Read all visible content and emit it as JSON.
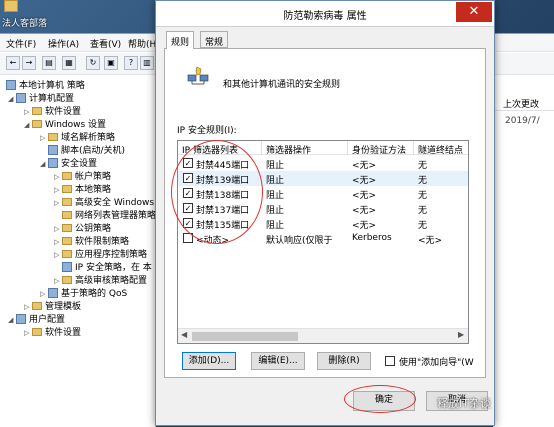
{
  "desktop": {
    "icon_label": "法人客部落"
  },
  "mmc": {
    "menu": [
      "文件(F)",
      "操作(A)",
      "查看(V)",
      "帮助(H)"
    ],
    "toolbar_icons": [
      "back-icon",
      "forward-icon",
      "up-icon",
      "show-hide-tree-icon",
      "refresh-icon",
      "export-icon",
      "help-icon",
      "properties-icon"
    ],
    "tree": [
      {
        "label": "本地计算机 策略",
        "indent": 0,
        "icon": "policy"
      },
      {
        "label": "计算机配置",
        "indent": 1,
        "icon": "computer"
      },
      {
        "label": "软件设置",
        "indent": 2,
        "icon": "folder"
      },
      {
        "label": "Windows 设置",
        "indent": 2,
        "icon": "folder"
      },
      {
        "label": "域名解析策略",
        "indent": 3,
        "icon": "folder"
      },
      {
        "label": "脚本(启动/关机)",
        "indent": 3,
        "icon": "script"
      },
      {
        "label": "安全设置",
        "indent": 3,
        "icon": "shield"
      },
      {
        "label": "帐户策略",
        "indent": 4,
        "icon": "folder"
      },
      {
        "label": "本地策略",
        "indent": 4,
        "icon": "folder"
      },
      {
        "label": "高级安全 Windows",
        "indent": 4,
        "icon": "folder"
      },
      {
        "label": "网络列表管理器策略",
        "indent": 4,
        "icon": "folder"
      },
      {
        "label": "公钥策略",
        "indent": 4,
        "icon": "folder"
      },
      {
        "label": "软件限制策略",
        "indent": 4,
        "icon": "folder"
      },
      {
        "label": "应用程序控制策略",
        "indent": 4,
        "icon": "folder"
      },
      {
        "label": "IP 安全策略，在 本",
        "indent": 4,
        "icon": "ipsec"
      },
      {
        "label": "高级审核策略配置",
        "indent": 4,
        "icon": "folder"
      },
      {
        "label": "基于策略的 QoS",
        "indent": 3,
        "icon": "chart"
      },
      {
        "label": "管理模板",
        "indent": 2,
        "icon": "folder"
      },
      {
        "label": "用户配置",
        "indent": 1,
        "icon": "user"
      },
      {
        "label": "软件设置",
        "indent": 2,
        "icon": "folder"
      }
    ],
    "right": {
      "column_header": "上次更改",
      "value": "2019/7/"
    }
  },
  "dialog": {
    "title": "防范勒索病毒 属性",
    "close_glyph": "✕",
    "tabs": [
      "规则",
      "常规"
    ],
    "rules_desc": "和其他计算机通讯的安全规则",
    "list_label": "IP 安全规则(I):",
    "columns": [
      "IP 筛选器列表",
      "筛选器操作",
      "身份验证方法",
      "隧道终结点"
    ],
    "rows": [
      {
        "checked": true,
        "filter": "封禁445端口",
        "action": "阻止",
        "auth": "<无>",
        "tunnel": "无"
      },
      {
        "checked": true,
        "filter": "封禁139端口",
        "action": "阻止",
        "auth": "<无>",
        "tunnel": "无"
      },
      {
        "checked": true,
        "filter": "封禁138端口",
        "action": "阻止",
        "auth": "<无>",
        "tunnel": "无"
      },
      {
        "checked": true,
        "filter": "封禁137端口",
        "action": "阻止",
        "auth": "<无>",
        "tunnel": "无"
      },
      {
        "checked": true,
        "filter": "封禁135端口",
        "action": "阻止",
        "auth": "<无>",
        "tunnel": "无"
      },
      {
        "checked": false,
        "filter": "<动态>",
        "action": "默认响应(仅限于",
        "auth": "Kerberos",
        "tunnel": "<无>"
      }
    ],
    "buttons": {
      "add": "添加(D)...",
      "edit": "编辑(E)...",
      "delete": "删除(R)",
      "wizard": "使用\"添加向导\"(W",
      "ok": "确定",
      "cancel": "取消"
    }
  },
  "watermark": "释放IT杂谈",
  "colors": {
    "annotation": "#e03030",
    "close_button": "#c42b1c",
    "selection": "#e5f1fb"
  }
}
